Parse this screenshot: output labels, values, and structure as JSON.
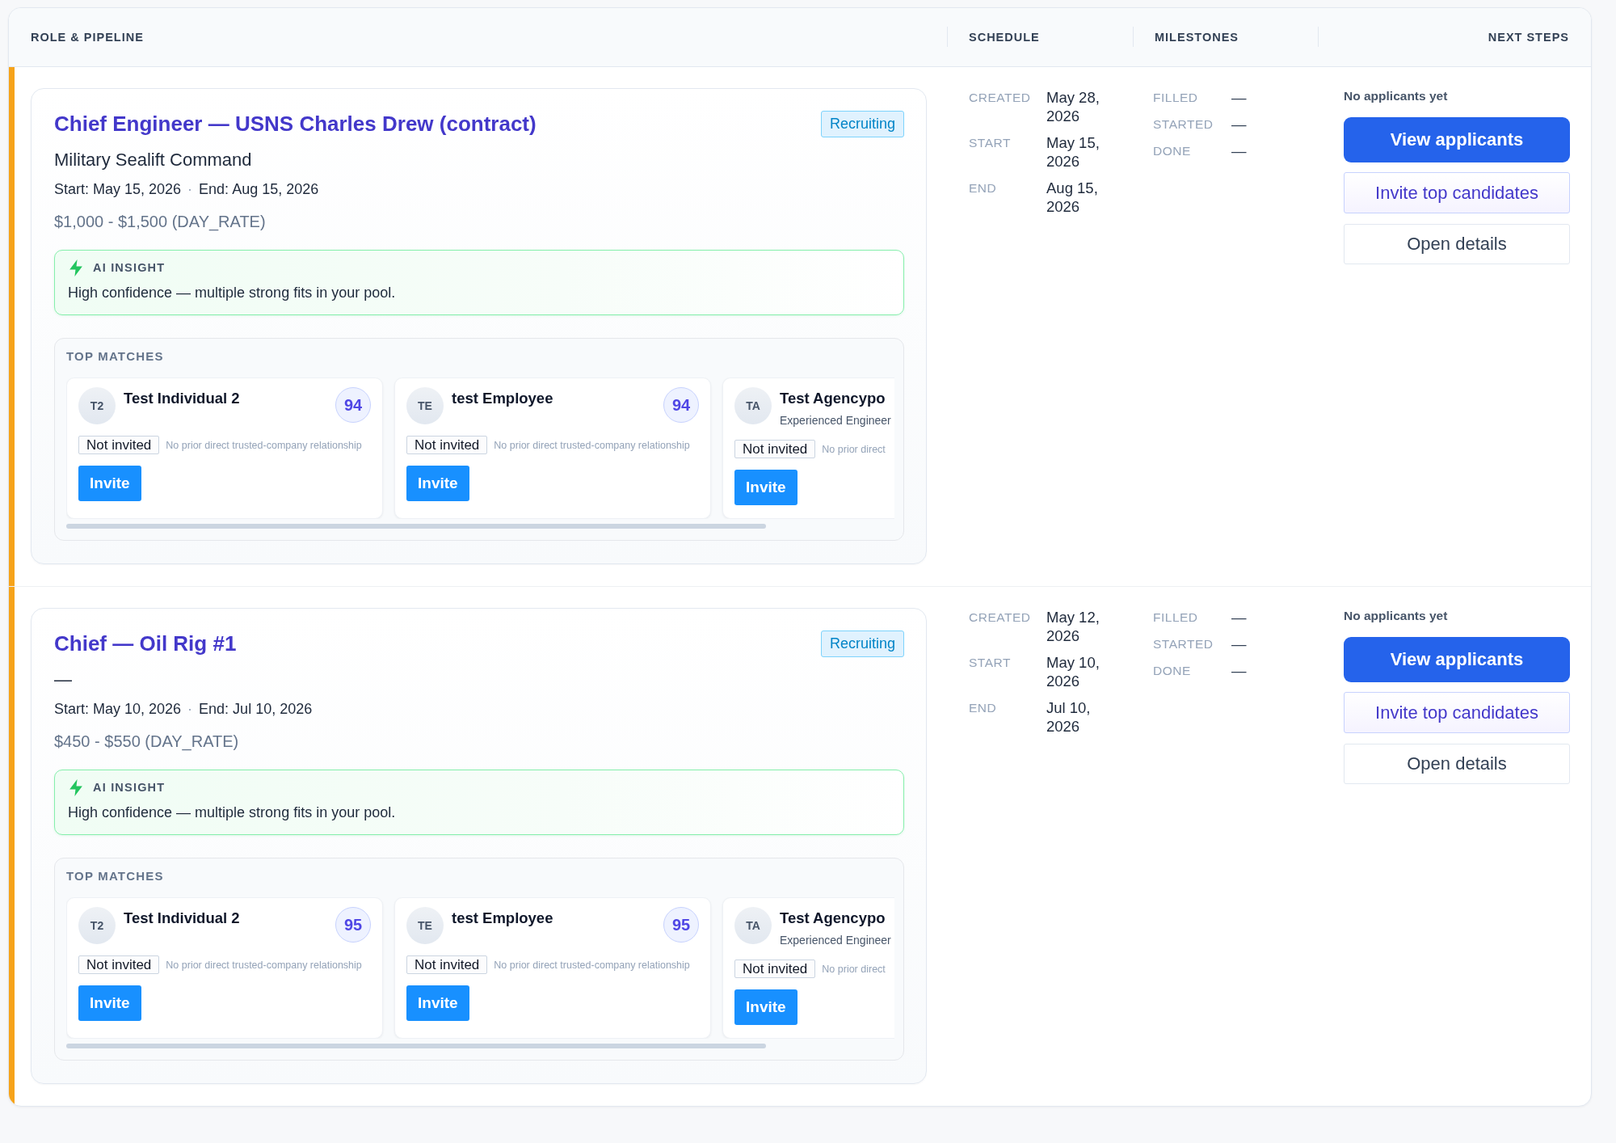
{
  "table": {
    "columns": [
      {
        "label": "ROLE & PIPELINE"
      },
      {
        "label": "SCHEDULE"
      },
      {
        "label": "MILESTONES"
      },
      {
        "label": "NEXT STEPS"
      }
    ],
    "rows": [
      {
        "role": {
          "title": "Chief Engineer — USNS Charles Drew (contract)",
          "status": "Recruiting",
          "company": "Military Sealift Command",
          "start": "Start: May 15, 2026",
          "separator": "·",
          "end": "End: Aug 15, 2026",
          "rate": "$1,000 - $1,500 (DAY_RATE)",
          "insight": {
            "label": "AI INSIGHT",
            "text": "High confidence — multiple strong fits in your pool."
          },
          "top_matches": {
            "label": "TOP MATCHES",
            "candidates": [
              {
                "initials": "T2",
                "name": "Test Individual 2",
                "score": "94",
                "status": "Not invited",
                "note": "No prior direct trusted-company relationship",
                "action": "Invite"
              },
              {
                "initials": "TE",
                "name": "test Employee",
                "score": "94",
                "status": "Not invited",
                "note": "No prior direct trusted-company relationship",
                "action": "Invite"
              },
              {
                "initials": "TA",
                "name": "Test Agencypo",
                "headline": "Experienced Engineer",
                "status": "Not invited",
                "note": "No prior direct",
                "action": "Invite"
              }
            ]
          }
        },
        "schedule": [
          {
            "label": "CREATED",
            "value": "May 28, 2026"
          },
          {
            "label": "START",
            "value": "May 15, 2026"
          },
          {
            "label": "END",
            "value": "Aug 15, 2026"
          }
        ],
        "milestones": [
          {
            "label": "FILLED",
            "value": "—"
          },
          {
            "label": "STARTED",
            "value": "—"
          },
          {
            "label": "DONE",
            "value": "—"
          }
        ],
        "next_steps": {
          "note": "No applicants yet",
          "actions": [
            {
              "kind": "primary",
              "label": "View applicants"
            },
            {
              "kind": "secondary",
              "label": "Invite top candidates"
            },
            {
              "kind": "plain",
              "label": "Open details"
            }
          ]
        }
      },
      {
        "role": {
          "title": "Chief — Oil Rig #1",
          "status": "Recruiting",
          "company": "—",
          "start": "Start: May 10, 2026",
          "separator": "·",
          "end": "End: Jul 10, 2026",
          "rate": "$450 - $550 (DAY_RATE)",
          "insight": {
            "label": "AI INSIGHT",
            "text": "High confidence — multiple strong fits in your pool."
          },
          "top_matches": {
            "label": "TOP MATCHES",
            "candidates": [
              {
                "initials": "T2",
                "name": "Test Individual 2",
                "score": "95",
                "status": "Not invited",
                "note": "No prior direct trusted-company relationship",
                "action": "Invite"
              },
              {
                "initials": "TE",
                "name": "test Employee",
                "score": "95",
                "status": "Not invited",
                "note": "No prior direct trusted-company relationship",
                "action": "Invite"
              },
              {
                "initials": "TA",
                "name": "Test Agencypo",
                "headline": "Experienced Engineer",
                "status": "Not invited",
                "note": "No prior direct",
                "action": "Invite"
              }
            ]
          }
        },
        "schedule": [
          {
            "label": "CREATED",
            "value": "May 12, 2026"
          },
          {
            "label": "START",
            "value": "May 10, 2026"
          },
          {
            "label": "END",
            "value": "Jul 10, 2026"
          }
        ],
        "milestones": [
          {
            "label": "FILLED",
            "value": "—"
          },
          {
            "label": "STARTED",
            "value": "—"
          },
          {
            "label": "DONE",
            "value": "—"
          }
        ],
        "next_steps": {
          "note": "No applicants yet",
          "actions": [
            {
              "kind": "primary",
              "label": "View applicants"
            },
            {
              "kind": "secondary",
              "label": "Invite top candidates"
            },
            {
              "kind": "plain",
              "label": "Open details"
            }
          ]
        }
      }
    ]
  }
}
